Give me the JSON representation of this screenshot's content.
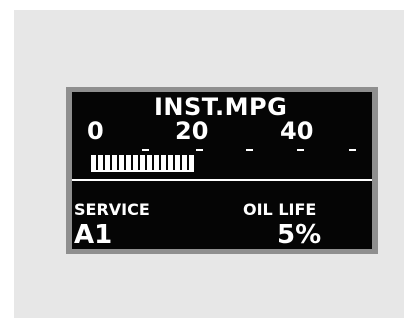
{
  "display": {
    "title": "INST.MPG",
    "scale": [
      "0",
      "20",
      "40"
    ],
    "mpg_fill_fraction": 0.37,
    "bar_segment_count": 15,
    "service_label": "SERVICE",
    "service_code": "A1",
    "oil_life_label": "OIL LIFE",
    "oil_life_value": "5%"
  },
  "colors": {
    "screen": "#050505",
    "segment": "#ffffff",
    "bezel": "#8f8f8f",
    "background": "#e7e7e7"
  }
}
